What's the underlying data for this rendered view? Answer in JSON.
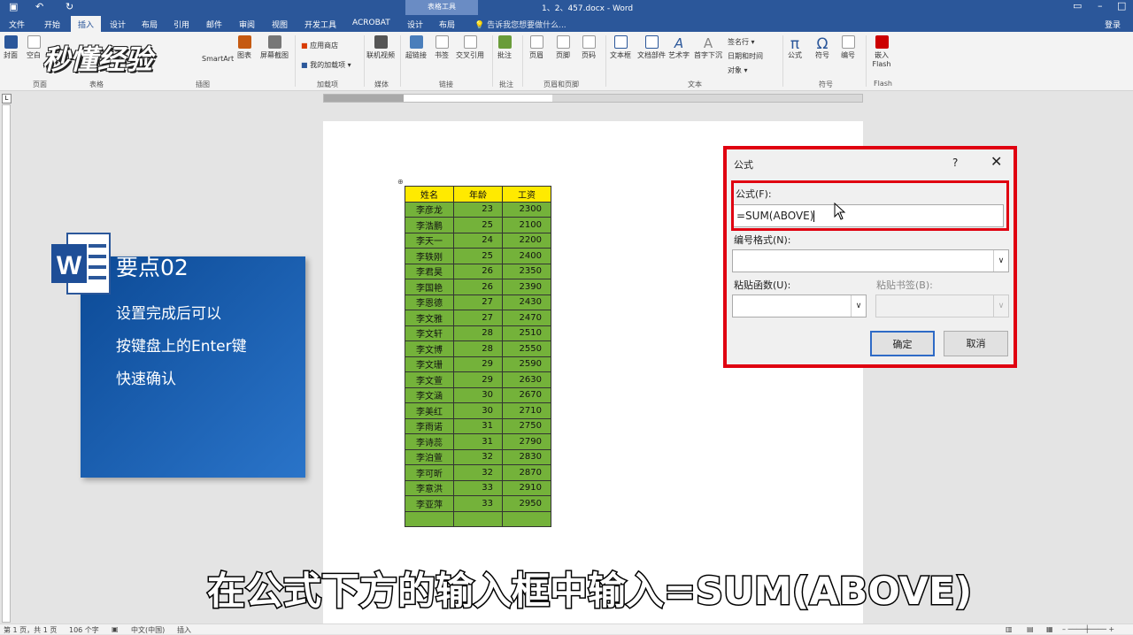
{
  "titlebar": {
    "context_tab": "表格工具",
    "doc_title": "1、2、457.docx - Word"
  },
  "tabs": {
    "items": [
      "文件",
      "开始",
      "插入",
      "设计",
      "布局",
      "引用",
      "邮件",
      "审阅",
      "视图",
      "开发工具",
      "ACROBAT",
      "设计",
      "布局"
    ],
    "tellme": "告诉我您想要做什么...",
    "login": "登录"
  },
  "ribbon": {
    "buttons": [
      "封面",
      "空白",
      "SmartArt",
      "图表",
      "屏幕截图",
      "联机视频",
      "超链接",
      "书签",
      "交叉引用",
      "批注",
      "页眉",
      "页脚",
      "页码",
      "文本框",
      "文档部件",
      "艺术字",
      "首字下沉",
      "公式",
      "符号",
      "编号",
      "嵌入Flash"
    ],
    "small_items": [
      "应用商店",
      "我的加载项",
      "签名行",
      "日期和时间",
      "对象"
    ],
    "groups": [
      "页面",
      "表格",
      "插图",
      "加载项",
      "媒体",
      "链接",
      "批注",
      "页眉和页脚",
      "文本",
      "符号",
      "Flash"
    ]
  },
  "logo": "秒懂经验",
  "table": {
    "headers": [
      "姓名",
      "年龄",
      "工资"
    ],
    "rows": [
      [
        "李彦龙",
        "23",
        "2300"
      ],
      [
        "李浩鹏",
        "25",
        "2100"
      ],
      [
        "李天一",
        "24",
        "2200"
      ],
      [
        "李轶刚",
        "25",
        "2400"
      ],
      [
        "李君昊",
        "26",
        "2350"
      ],
      [
        "李国艳",
        "26",
        "2390"
      ],
      [
        "李恩德",
        "27",
        "2430"
      ],
      [
        "李文雅",
        "27",
        "2470"
      ],
      [
        "李文轩",
        "28",
        "2510"
      ],
      [
        "李文博",
        "28",
        "2550"
      ],
      [
        "李文珊",
        "29",
        "2590"
      ],
      [
        "李文萱",
        "29",
        "2630"
      ],
      [
        "李文涵",
        "30",
        "2670"
      ],
      [
        "李美红",
        "30",
        "2710"
      ],
      [
        "李雨诺",
        "31",
        "2750"
      ],
      [
        "李诗蕊",
        "31",
        "2790"
      ],
      [
        "李泊萱",
        "32",
        "2830"
      ],
      [
        "李可昕",
        "32",
        "2870"
      ],
      [
        "李意洪",
        "33",
        "2910"
      ],
      [
        "李亚萍",
        "33",
        "2950"
      ]
    ]
  },
  "card": {
    "title": "要点02",
    "lines": [
      "设置完成后可以",
      "按键盘上的Enter键",
      "快速确认"
    ]
  },
  "dialog": {
    "title": "公式",
    "help": "?",
    "close": "✕",
    "formula_label": "公式(F):",
    "formula_value": "=SUM(ABOVE)",
    "numformat_label": "编号格式(N):",
    "paste_func_label": "粘贴函数(U):",
    "paste_bookmark_label": "粘贴书签(B):",
    "ok": "确定",
    "cancel": "取消"
  },
  "subtitle": "在公式下方的输入框中输入=SUM(ABOVE)",
  "statusbar": {
    "page": "第 1 页，共 1 页",
    "words": "106 个字",
    "lang": "中文(中国)",
    "mode": "插入"
  }
}
